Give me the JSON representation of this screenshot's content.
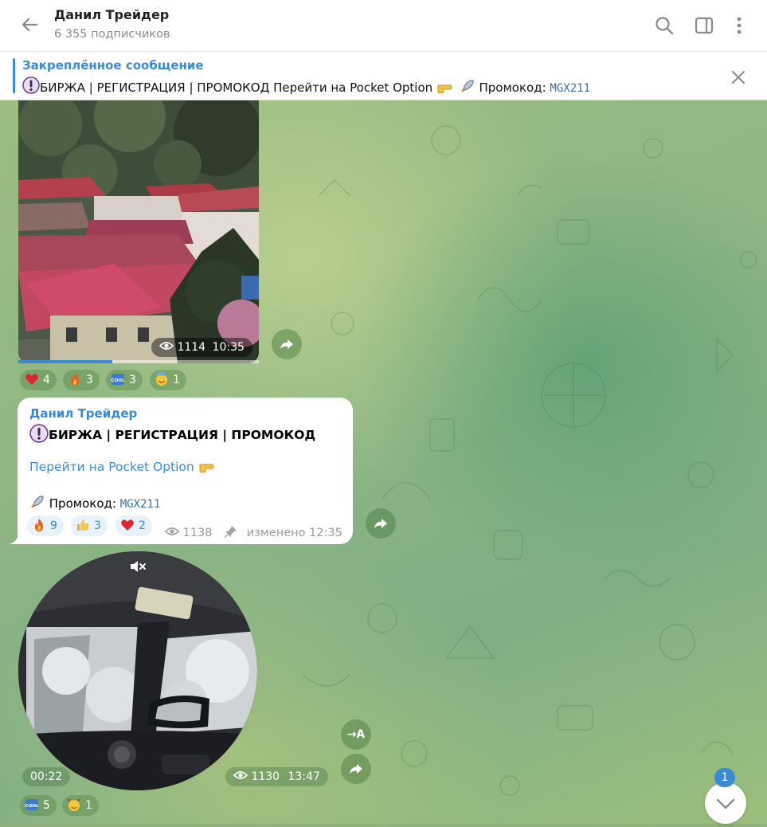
{
  "header": {
    "title": "Данил Трейдер",
    "subscribers": "6 355 подписчиков",
    "icons": [
      "back-arrow-icon",
      "search-icon",
      "sidebar-toggle-icon",
      "more-vertical-icon"
    ]
  },
  "pinned": {
    "title": "Закреплённое сообщение",
    "text_main": "БИРЖА | РЕГИСТРАЦИЯ | ПРОМОКОД  Перейти на Pocket Option",
    "promo_label": "Промокод:",
    "promo_code": "MGX211"
  },
  "video1": {
    "views": "1114",
    "time": "10:35",
    "progress": 0.39,
    "reactions": [
      {
        "icon": "heart-icon",
        "count": "4"
      },
      {
        "icon": "fire-icon",
        "count": "3"
      },
      {
        "icon": "cool-icon",
        "count": "3"
      },
      {
        "icon": "halo-smile-icon",
        "count": "1"
      }
    ]
  },
  "post": {
    "author": "Данил Трейдер",
    "line1": "БИРЖА | РЕГИСТРАЦИЯ | ПРОМОКОД",
    "link": "Перейти на Pocket Option",
    "promo_label": "Промокод:",
    "promo_code": "MGX211",
    "reactions": [
      {
        "icon": "fire-icon",
        "count": "9"
      },
      {
        "icon": "thumbs-up-icon",
        "count": "3"
      },
      {
        "icon": "heart-icon",
        "count": "2"
      }
    ],
    "views": "1138",
    "edited": "изменено 12:35"
  },
  "round_video": {
    "duration": "00:22",
    "views": "1130",
    "time": "13:47",
    "translate_label": "→A",
    "reactions": [
      {
        "icon": "cool-icon",
        "count": "5"
      },
      {
        "icon": "hearts-face-icon",
        "count": "1"
      }
    ]
  },
  "scroll": {
    "unread": "1"
  },
  "colors": {
    "accent": "#3a8bd6",
    "chat_bg": "#8fb07a"
  }
}
